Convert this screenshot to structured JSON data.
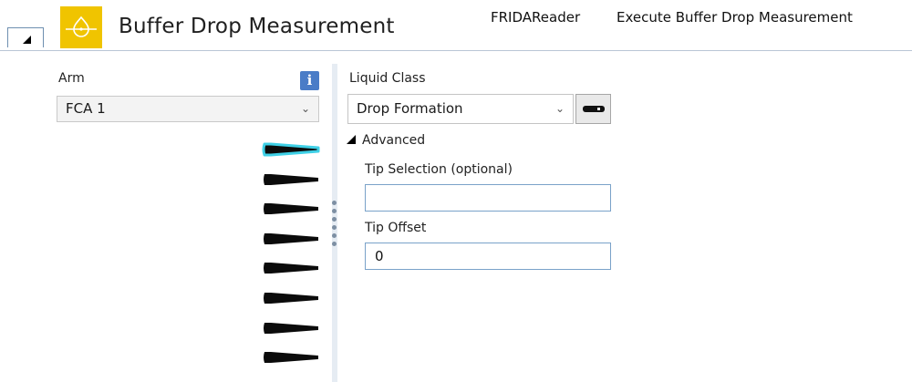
{
  "header": {
    "title": "Buffer Drop Measurement",
    "breadcrumbs": [
      "FRIDAReader",
      "Execute Buffer Drop Measurement"
    ],
    "logo_icon": "pipette-drop-icon",
    "collapse_icon": "triangle-collapse-icon",
    "brand_color": "#f0c400"
  },
  "arm": {
    "label": "Arm",
    "selected": "FCA 1",
    "info_glyph": "i",
    "tips": [
      {
        "name": "tip-1",
        "selected": true
      },
      {
        "name": "tip-2",
        "selected": false
      },
      {
        "name": "tip-3",
        "selected": false
      },
      {
        "name": "tip-4",
        "selected": false
      },
      {
        "name": "tip-5",
        "selected": false
      },
      {
        "name": "tip-6",
        "selected": false
      },
      {
        "name": "tip-7",
        "selected": false
      },
      {
        "name": "tip-8",
        "selected": false
      }
    ],
    "tip_highlight_color": "#3fd0e6"
  },
  "liquid_class": {
    "label": "Liquid Class",
    "selected": "Drop Formation"
  },
  "advanced": {
    "toggle_label": "Advanced",
    "expanded": true,
    "tip_selection": {
      "label": "Tip Selection (optional)",
      "value": ""
    },
    "tip_offset": {
      "label": "Tip Offset",
      "value": "0"
    }
  }
}
